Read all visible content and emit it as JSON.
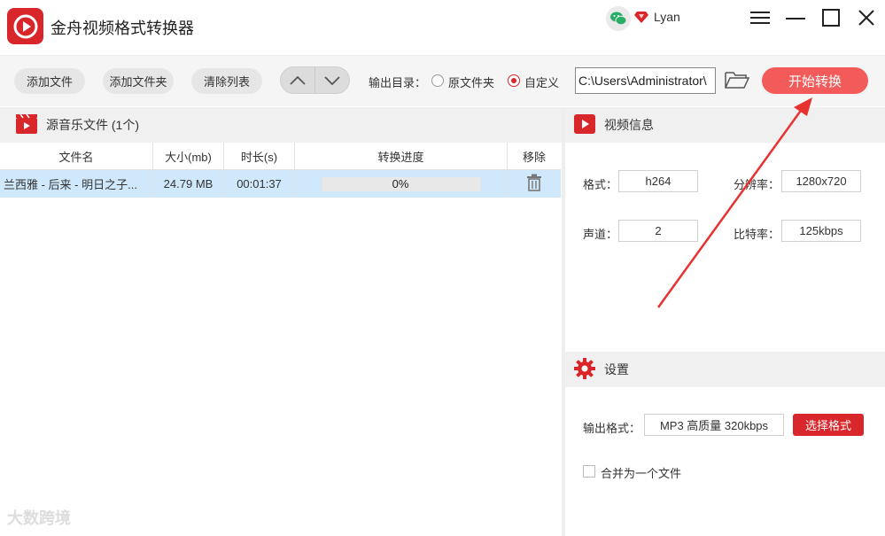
{
  "app": {
    "title": "金舟视频格式转换器"
  },
  "user": {
    "name": "Lyan"
  },
  "toolbar": {
    "add_file": "添加文件",
    "add_folder": "添加文件夹",
    "clear_list": "清除列表",
    "output_dir_label": "输出目录：",
    "option_original": "原文件夹",
    "option_custom": "自定义",
    "selected_option": "custom",
    "output_path": "C:\\Users\\Administrator\\",
    "start_button": "开始转换"
  },
  "file_list": {
    "header": "源音乐文件 (1个)",
    "columns": [
      "文件名",
      "大小(mb)",
      "时长(s)",
      "转换进度",
      "移除"
    ],
    "rows": [
      {
        "name": "兰西雅 - 后来 - 明日之子...",
        "size": "24.79 MB",
        "duration": "00:01:37",
        "progress_text": "0%",
        "progress": 0
      }
    ]
  },
  "video_info": {
    "header": "视频信息",
    "format_label": "格式：",
    "format": "h264",
    "resolution_label": "分辨率：",
    "resolution": "1280x720",
    "channels_label": "声道：",
    "channels": "2",
    "bitrate_label": "比特率：",
    "bitrate": "125kbps"
  },
  "settings": {
    "header": "设置",
    "output_format_label": "输出格式：",
    "output_format": "MP3 高质量 320kbps",
    "choose_format": "选择格式",
    "merge_label": "合并为一个文件",
    "merge_checked": false
  },
  "watermark": "大数跨境",
  "colors": {
    "brand_red": "#d9262b",
    "start_button": "#f35b5b",
    "row_selected": "#cfe8fb"
  }
}
